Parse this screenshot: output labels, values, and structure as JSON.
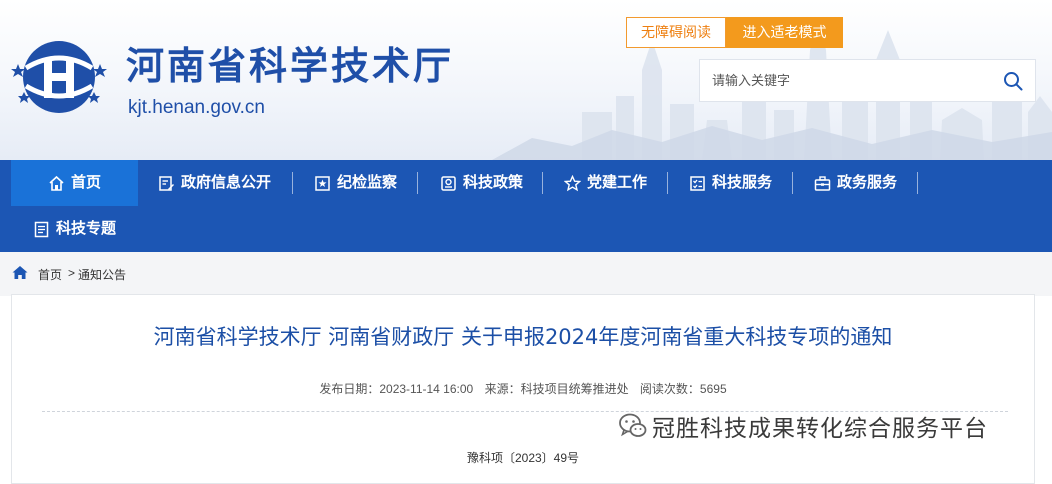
{
  "header": {
    "site_title": "河南省科学技术厅",
    "site_domain": "kjt.henan.gov.cn",
    "accessibility_button": "无障碍阅读",
    "elder_mode_button": "进入适老模式",
    "search_placeholder": "请输入关键字",
    "accent_color": "#1c56b4",
    "orange_color": "#f39a1d"
  },
  "nav": {
    "items": [
      {
        "label": "首页",
        "icon": "home-icon",
        "active": true
      },
      {
        "label": "政府信息公开",
        "icon": "document-edit-icon",
        "active": false
      },
      {
        "label": "纪检监察",
        "icon": "inspection-icon",
        "active": false
      },
      {
        "label": "科技政策",
        "icon": "policy-icon",
        "active": false
      },
      {
        "label": "党建工作",
        "icon": "star-icon",
        "active": false
      },
      {
        "label": "科技服务",
        "icon": "checklist-icon",
        "active": false
      },
      {
        "label": "政务服务",
        "icon": "briefcase-icon",
        "active": false
      },
      {
        "label": "科技专题",
        "icon": "topic-doc-icon",
        "active": false
      }
    ]
  },
  "breadcrumb": {
    "home": "首页",
    "separator": ">",
    "current": "通知公告"
  },
  "article": {
    "title": "河南省科学技术厅 河南省财政厅 关于申报2024年度河南省重大科技专项的通知",
    "publish_date": "发布日期：2023-11-14 16:00",
    "source": "来源：科技项目统筹推进处",
    "views": "阅读次数：5695",
    "doc_number": "豫科项〔2023〕49号"
  },
  "watermark": {
    "text": "冠胜科技成果转化综合服务平台",
    "icon": "wechat-icon"
  }
}
